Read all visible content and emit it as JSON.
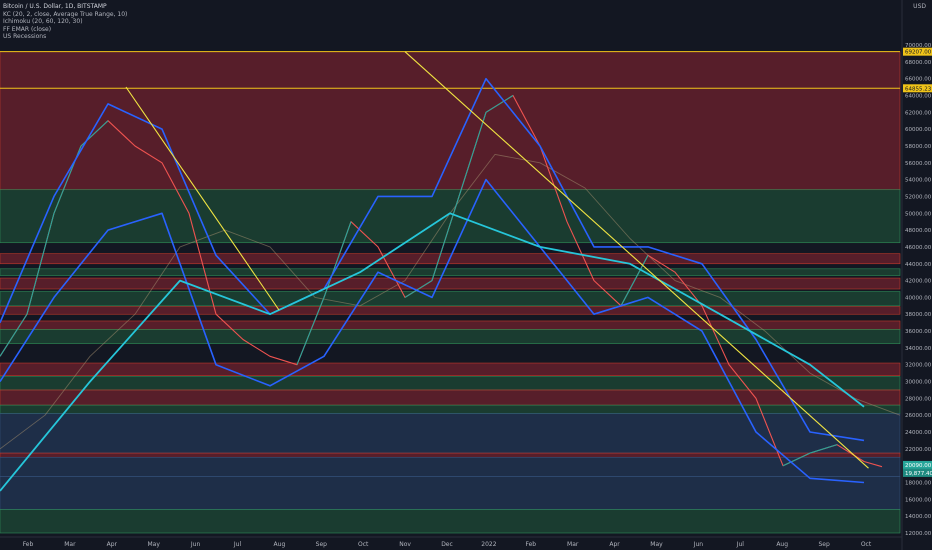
{
  "header": {
    "symbol_line": "Bitcoin / U.S. Dollar, 1D, BITSTAMP",
    "indicators": [
      "KC (20, 2, close, Average True Range, 10)",
      "Ichimoku (20, 60, 120, 30)",
      "FF EMAR (close)",
      "US Recessions"
    ],
    "currency": "USD"
  },
  "colors": {
    "background": "#131722",
    "price_up": "#26a69a",
    "price_down": "#ef5350",
    "keltner": "#2962ff",
    "ema": "#26c6da",
    "trendline": "#f0e442",
    "current_price": "#26a69a"
  },
  "chart_data": {
    "type": "line",
    "title": "Bitcoin / U.S. Dollar, 1D, BITSTAMP",
    "xlabel": "",
    "ylabel": "",
    "ylim": [
      12000,
      72000
    ],
    "grid": false,
    "x_ticks": [
      "Feb",
      "Mar",
      "Apr",
      "May",
      "Jun",
      "Jul",
      "Aug",
      "Sep",
      "Oct",
      "Nov",
      "Dec",
      "2022",
      "Feb",
      "Mar",
      "Apr",
      "May",
      "Jun",
      "Jul",
      "Aug",
      "Sep",
      "Oct"
    ],
    "y_ticks": [
      12000,
      14000,
      16000,
      18000,
      20000,
      22000,
      24000,
      26000,
      28000,
      30000,
      32000,
      34000,
      36000,
      38000,
      40000,
      42000,
      44000,
      46000,
      48000,
      50000,
      52000,
      54000,
      56000,
      58000,
      60000,
      62000,
      64000,
      66000,
      68000,
      70000
    ],
    "y_tick_labels": [
      "12000.00",
      "14000.00",
      "16000.00",
      "18000.00",
      "20000.00",
      "22000.00",
      "24000.00",
      "26000.00",
      "28000.00",
      "30000.00",
      "32000.00",
      "34000.00",
      "36000.00",
      "38000.00",
      "40000.00",
      "42000.00",
      "44000.00",
      "46000.00",
      "48000.00",
      "50000.00",
      "52000.00",
      "54000.00",
      "56000.00",
      "58000.00",
      "60000.00",
      "62000.00",
      "64000.00",
      "66000.00",
      "68000.00",
      "70000.00"
    ],
    "price_labels": [
      {
        "text": "69207.00",
        "value": 69207,
        "kind": "level"
      },
      {
        "text": "64855.23",
        "value": 64855,
        "kind": "level"
      },
      {
        "text": "20090.00",
        "value": 20090,
        "kind": "current"
      },
      {
        "text": "19,877.40",
        "value": 19877,
        "kind": "current-alt"
      }
    ],
    "zones": [
      {
        "from": 52800,
        "to": 69207,
        "color": "red"
      },
      {
        "from": 46500,
        "to": 52800,
        "color": "green"
      },
      {
        "from": 44000,
        "to": 45200,
        "color": "red"
      },
      {
        "from": 42600,
        "to": 43400,
        "color": "green"
      },
      {
        "from": 41000,
        "to": 42300,
        "color": "red"
      },
      {
        "from": 39000,
        "to": 40700,
        "color": "green"
      },
      {
        "from": 38000,
        "to": 38900,
        "color": "red"
      },
      {
        "from": 36200,
        "to": 37200,
        "color": "red"
      },
      {
        "from": 34500,
        "to": 36200,
        "color": "green"
      },
      {
        "from": 30700,
        "to": 32200,
        "color": "red"
      },
      {
        "from": 29000,
        "to": 30600,
        "color": "green"
      },
      {
        "from": 27200,
        "to": 29000,
        "color": "red"
      },
      {
        "from": 26200,
        "to": 27200,
        "color": "green"
      },
      {
        "from": 21500,
        "to": 26200,
        "color": "blue"
      },
      {
        "from": 21000,
        "to": 21500,
        "color": "red"
      },
      {
        "from": 18700,
        "to": 21000,
        "color": "blue"
      },
      {
        "from": 14800,
        "to": 18700,
        "color": "blue"
      },
      {
        "from": 12000,
        "to": 14800,
        "color": "green"
      }
    ],
    "series": [
      {
        "role": "ichimoku-span",
        "x": [
          0,
          0.05,
          0.1,
          0.15,
          0.2,
          0.25,
          0.3,
          0.35,
          0.4,
          0.45,
          0.5,
          0.55,
          0.6,
          0.65,
          0.7,
          0.75,
          0.8,
          0.85,
          0.9,
          0.95,
          1.0
        ],
        "values": [
          22000,
          26000,
          33000,
          38000,
          46000,
          48000,
          46000,
          40000,
          39000,
          42000,
          50000,
          57000,
          56000,
          53000,
          47000,
          42000,
          40000,
          36000,
          31000,
          28000,
          26000
        ]
      },
      {
        "role": "price",
        "x": [
          0,
          0.03,
          0.06,
          0.09,
          0.12,
          0.15,
          0.18,
          0.21,
          0.24,
          0.27,
          0.3,
          0.33,
          0.36,
          0.39,
          0.42,
          0.45,
          0.48,
          0.51,
          0.54,
          0.57,
          0.6,
          0.63,
          0.66,
          0.69,
          0.72,
          0.75,
          0.78,
          0.81,
          0.84,
          0.87,
          0.9,
          0.93,
          0.96,
          0.98
        ],
        "values": [
          33000,
          38000,
          50000,
          58000,
          61000,
          58000,
          56000,
          50000,
          38000,
          35000,
          33000,
          32000,
          40000,
          49000,
          46000,
          40000,
          42000,
          52000,
          62000,
          64000,
          58000,
          49000,
          42000,
          39000,
          45000,
          43000,
          39000,
          32000,
          28000,
          20000,
          21500,
          22500,
          20500,
          19877
        ]
      },
      {
        "role": "keltner-upper",
        "x": [
          0,
          0.06,
          0.12,
          0.18,
          0.24,
          0.3,
          0.36,
          0.42,
          0.48,
          0.54,
          0.6,
          0.66,
          0.72,
          0.78,
          0.84,
          0.9,
          0.96
        ],
        "values": [
          37000,
          52000,
          63000,
          60000,
          45000,
          38000,
          41000,
          52000,
          52000,
          66000,
          58000,
          46000,
          46000,
          44000,
          35000,
          24000,
          23000
        ]
      },
      {
        "role": "keltner-lower",
        "x": [
          0,
          0.06,
          0.12,
          0.18,
          0.24,
          0.3,
          0.36,
          0.42,
          0.48,
          0.54,
          0.6,
          0.66,
          0.72,
          0.78,
          0.84,
          0.9,
          0.96
        ],
        "values": [
          30000,
          40000,
          48000,
          50000,
          32000,
          29500,
          33000,
          43000,
          40000,
          54000,
          46000,
          38000,
          40000,
          36000,
          24000,
          18500,
          18000
        ]
      },
      {
        "role": "ema",
        "x": [
          0,
          0.1,
          0.2,
          0.3,
          0.4,
          0.5,
          0.6,
          0.7,
          0.8,
          0.9,
          0.96
        ],
        "values": [
          17000,
          30000,
          42000,
          38000,
          43000,
          50000,
          46000,
          44000,
          38000,
          32000,
          27000
        ]
      },
      {
        "role": "trendline",
        "x": [
          0.14,
          0.31
        ],
        "values": [
          65000,
          38500
        ]
      },
      {
        "role": "trendline",
        "x": [
          0.45,
          0.965
        ],
        "values": [
          69207,
          19700
        ]
      }
    ]
  }
}
